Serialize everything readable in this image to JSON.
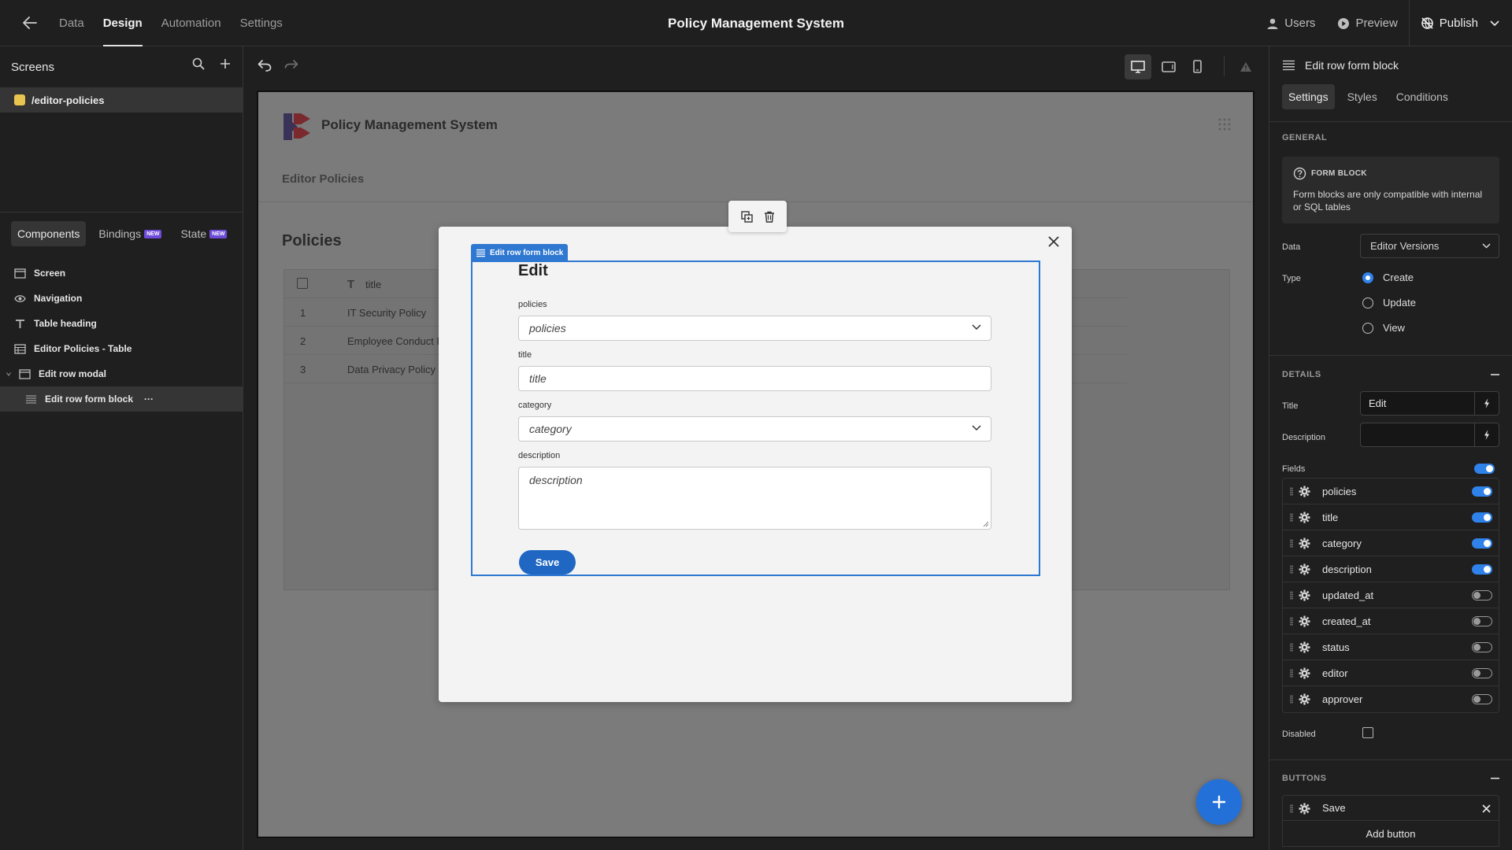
{
  "topbar": {
    "nav": [
      {
        "label": "Data"
      },
      {
        "label": "Design"
      },
      {
        "label": "Automation"
      },
      {
        "label": "Settings"
      }
    ],
    "app_title": "Policy Management System",
    "users_label": "Users",
    "preview_label": "Preview",
    "publish_label": "Publish"
  },
  "left": {
    "screens_label": "Screens",
    "screen_route": "/editor-policies",
    "tabs": {
      "components": "Components",
      "bindings": "Bindings",
      "state": "State",
      "new_badge": "NEW"
    },
    "tree": [
      {
        "label": "Screen"
      },
      {
        "label": "Navigation"
      },
      {
        "label": "Table heading"
      },
      {
        "label": "Editor Policies - Table"
      },
      {
        "label": "Edit row modal"
      },
      {
        "label": "Edit row form block"
      }
    ],
    "more_label": "···"
  },
  "canvas": {
    "app_title": "Policy Management System",
    "nav_item": "Editor Policies",
    "heading": "Policies",
    "table": {
      "column": "title",
      "rows": [
        {
          "num": "1",
          "title": "IT Security Policy"
        },
        {
          "num": "2",
          "title": "Employee Conduct P"
        },
        {
          "num": "3",
          "title": "Data Privacy Policy"
        }
      ]
    },
    "form_block_label": "Edit row form block",
    "form": {
      "title": "Edit",
      "fields": [
        {
          "label": "policies",
          "placeholder": "policies"
        },
        {
          "label": "title",
          "placeholder": "title"
        },
        {
          "label": "category",
          "placeholder": "category"
        },
        {
          "label": "description",
          "placeholder": "description"
        }
      ],
      "save_label": "Save"
    }
  },
  "right": {
    "title": "Edit row form block",
    "tabs": [
      "Settings",
      "Styles",
      "Conditions"
    ],
    "general_label": "GENERAL",
    "info_title": "FORM BLOCK",
    "info_text": "Form blocks are only compatible with internal or SQL tables",
    "data_label": "Data",
    "data_value": "Editor Versions",
    "type_label": "Type",
    "type_options": [
      "Create",
      "Update",
      "View"
    ],
    "type_selected": "Create",
    "details_label": "DETAILS",
    "title_label": "Title",
    "title_value": "Edit",
    "description_label": "Description",
    "description_value": "",
    "fields_label": "Fields",
    "fields": [
      {
        "name": "policies",
        "on": true
      },
      {
        "name": "title",
        "on": true
      },
      {
        "name": "category",
        "on": true
      },
      {
        "name": "description",
        "on": true
      },
      {
        "name": "updated_at",
        "on": false
      },
      {
        "name": "created_at",
        "on": false
      },
      {
        "name": "status",
        "on": false
      },
      {
        "name": "editor",
        "on": false
      },
      {
        "name": "approver",
        "on": false
      }
    ],
    "disabled_label": "Disabled",
    "buttons_label": "BUTTONS",
    "button_name": "Save",
    "add_button_label": "Add button"
  }
}
